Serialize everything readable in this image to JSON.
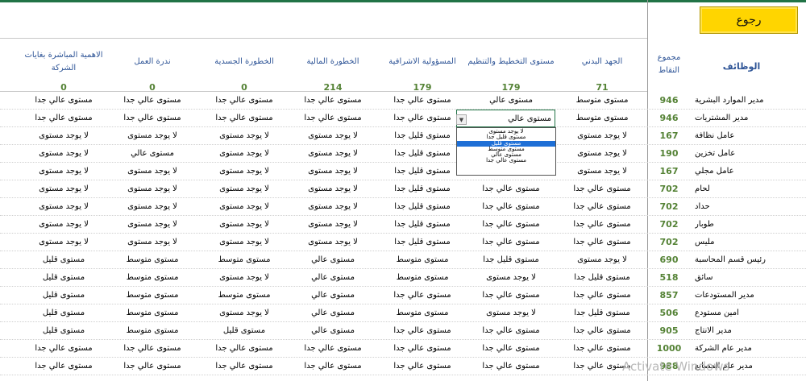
{
  "back_button": "رجوع",
  "header": {
    "jobs": "الوظائف",
    "total": "مجموع النقاط",
    "columns": [
      {
        "label": "الجهد البدني",
        "total": "71"
      },
      {
        "label": "مستوى التخطيط والتنظيم",
        "total": "179"
      },
      {
        "label": "المسؤولية الاشرافية",
        "total": "179"
      },
      {
        "label": "الخطورة المالية",
        "total": "214"
      },
      {
        "label": "الخطورة الجسدية",
        "total": "0"
      },
      {
        "label": "ندرة العمل",
        "total": "0"
      },
      {
        "label": "الاهمية المباشرة بغايات الشركة",
        "total": "0"
      }
    ]
  },
  "rows": [
    {
      "job": "مدير الموارد البشرية",
      "total": "946",
      "values": [
        "مستوى متوسط",
        "مستوى عالي",
        "مستوى عالي جدا",
        "مستوى عالي جدا",
        "مستوى عالي جدا",
        "مستوى عالي جدا",
        "مستوى عالي جدا"
      ]
    },
    {
      "job": "مدير المشتريات",
      "total": "946",
      "values": [
        "مستوى متوسط",
        "مستوى عالي",
        "مستوى عالي جدا",
        "مستوى عالي جدا",
        "مستوى عالي جدا",
        "مستوى عالي جدا",
        "مستوى عالي جدا"
      ]
    },
    {
      "job": "عامل نظافة",
      "total": "167",
      "values": [
        "لا يوجد مستوى",
        "",
        "مستوى قليل جدا",
        "لا يوجد مستوى",
        "لا يوجد مستوى",
        "لا يوجد مستوى",
        "لا يوجد مستوى"
      ]
    },
    {
      "job": "عامل تخزين",
      "total": "190",
      "values": [
        "لا يوجد مستوى",
        "",
        "مستوى قليل جدا",
        "لا يوجد مستوى",
        "لا يوجد مستوى",
        "مستوى عالي",
        "لا يوجد مستوى"
      ]
    },
    {
      "job": "عامل مجلي",
      "total": "167",
      "values": [
        "لا يوجد مستوى",
        "",
        "مستوى قليل جدا",
        "لا يوجد مستوى",
        "لا يوجد مستوى",
        "لا يوجد مستوى",
        "لا يوجد مستوى"
      ]
    },
    {
      "job": "لحام",
      "total": "702",
      "values": [
        "مستوى عالي جدا",
        "مستوى عالي جدا",
        "مستوى قليل جدا",
        "لا يوجد مستوى",
        "لا يوجد مستوى",
        "لا يوجد مستوى",
        "لا يوجد مستوى"
      ]
    },
    {
      "job": "حداد",
      "total": "702",
      "values": [
        "مستوى عالي جدا",
        "مستوى عالي جدا",
        "مستوى قليل جدا",
        "لا يوجد مستوى",
        "لا يوجد مستوى",
        "لا يوجد مستوى",
        "لا يوجد مستوى"
      ]
    },
    {
      "job": "طوبار",
      "total": "702",
      "values": [
        "مستوى عالي جدا",
        "مستوى عالي جدا",
        "مستوى قليل جدا",
        "لا يوجد مستوى",
        "لا يوجد مستوى",
        "لا يوجد مستوى",
        "لا يوجد مستوى"
      ]
    },
    {
      "job": "مليس",
      "total": "702",
      "values": [
        "مستوى عالي جدا",
        "مستوى عالي جدا",
        "مستوى قليل جدا",
        "لا يوجد مستوى",
        "لا يوجد مستوى",
        "لا يوجد مستوى",
        "لا يوجد مستوى"
      ]
    },
    {
      "job": "رئيس قسم المحاسبة",
      "total": "690",
      "values": [
        "لا يوجد مستوى",
        "مستوى قليل جدا",
        "مستوى متوسط",
        "مستوى عالي",
        "مستوى متوسط",
        "مستوى متوسط",
        "مستوى قليل"
      ]
    },
    {
      "job": "سائق",
      "total": "518",
      "values": [
        "مستوى قليل جدا",
        "لا يوجد مستوى",
        "مستوى متوسط",
        "مستوى عالي",
        "لا يوجد مستوى",
        "مستوى متوسط",
        "مستوى قليل"
      ]
    },
    {
      "job": "مدير المستودعات",
      "total": "857",
      "values": [
        "مستوى عالي جدا",
        "مستوى عالي جدا",
        "مستوى عالي جدا",
        "مستوى عالي",
        "مستوى متوسط",
        "مستوى متوسط",
        "مستوى قليل"
      ]
    },
    {
      "job": "امين مستودع",
      "total": "506",
      "values": [
        "مستوى قليل جدا",
        "لا يوجد مستوى",
        "مستوى متوسط",
        "مستوى عالي",
        "لا يوجد مستوى",
        "مستوى متوسط",
        "مستوى قليل"
      ]
    },
    {
      "job": "مدير الانتاج",
      "total": "905",
      "values": [
        "مستوى عالي جدا",
        "مستوى عالي جدا",
        "مستوى عالي جدا",
        "مستوى عالي",
        "مستوى قليل",
        "مستوى متوسط",
        "مستوى قليل"
      ]
    },
    {
      "job": "مدير عام الشركة",
      "total": "1000",
      "values": [
        "مستوى عالي جدا",
        "مستوى عالي جدا",
        "مستوى عالي جدا",
        "مستوى عالي جدا",
        "مستوى عالي جدا",
        "مستوى عالي جدا",
        "مستوى عالي جدا"
      ]
    },
    {
      "job": "مدير عام المصانع",
      "total": "988",
      "values": [
        "مستوى عالي جدا",
        "مستوى عالي جدا",
        "مستوى عالي جدا",
        "مستوى عالي جدا",
        "مستوى عالي جدا",
        "مستوى عالي جدا",
        "مستوى عالي جدا"
      ]
    }
  ],
  "dropdown": {
    "value": "مستوى عالي",
    "options": [
      "لا يوجد مستوى",
      "مستوى قليل جدا",
      "مستوى قليل",
      "مستوى متوسط",
      "مستوى عالي",
      "مستوى عالي جدا"
    ],
    "highlighted": "مستوى قليل"
  },
  "watermark": "Activate Windows"
}
